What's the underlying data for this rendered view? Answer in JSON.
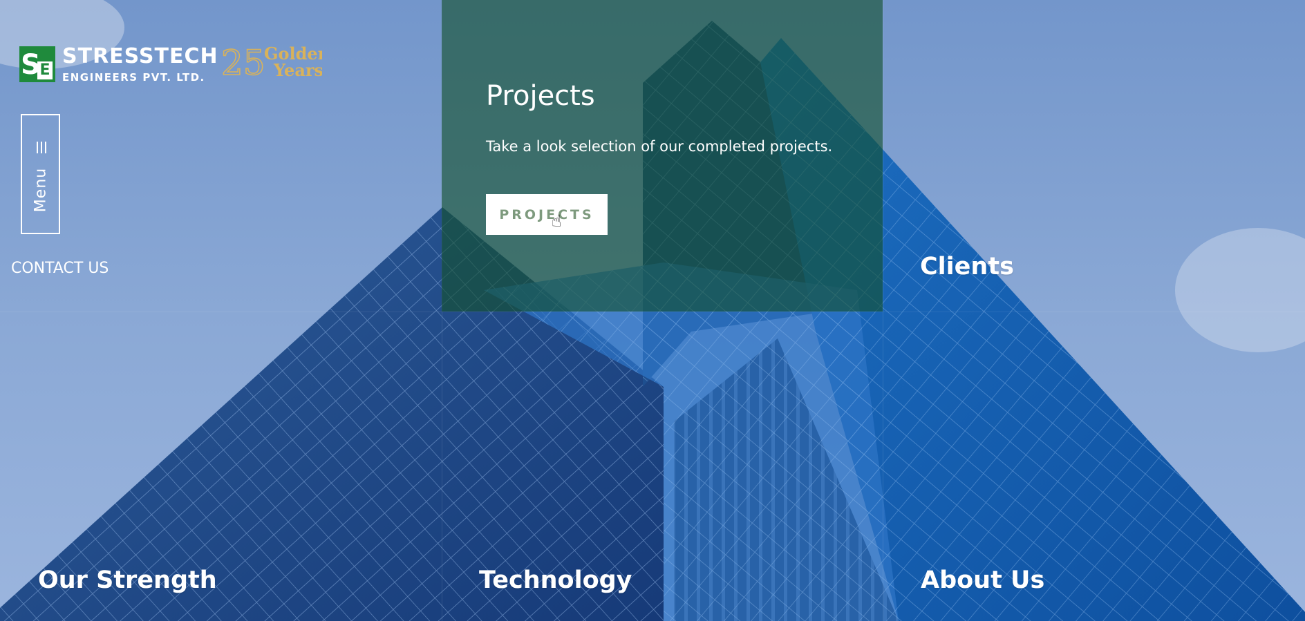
{
  "logo": {
    "company_name": "STRESSTECH",
    "company_suffix": "ENGINEERS PVT. LTD.",
    "mark_s": "S",
    "mark_e": "E",
    "anniversary_number": "25",
    "anniversary_text_1": "Golden",
    "anniversary_text_2": "Years"
  },
  "menu": {
    "label": "Menu",
    "icon": "hamburger-icon"
  },
  "contact": {
    "label": "CONTACT US"
  },
  "panel": {
    "title": "Projects",
    "description": "Take a look selection of our completed projects.",
    "button_label": "PROJECTS"
  },
  "nav": {
    "clients": "Clients",
    "our_strength": "Our Strength",
    "technology": "Technology",
    "about_us": "About Us"
  },
  "colors": {
    "brand_green": "#1f8a3c",
    "gold": "#d9b25a",
    "panel_overlay": "rgba(20,80,45,0.62)"
  }
}
